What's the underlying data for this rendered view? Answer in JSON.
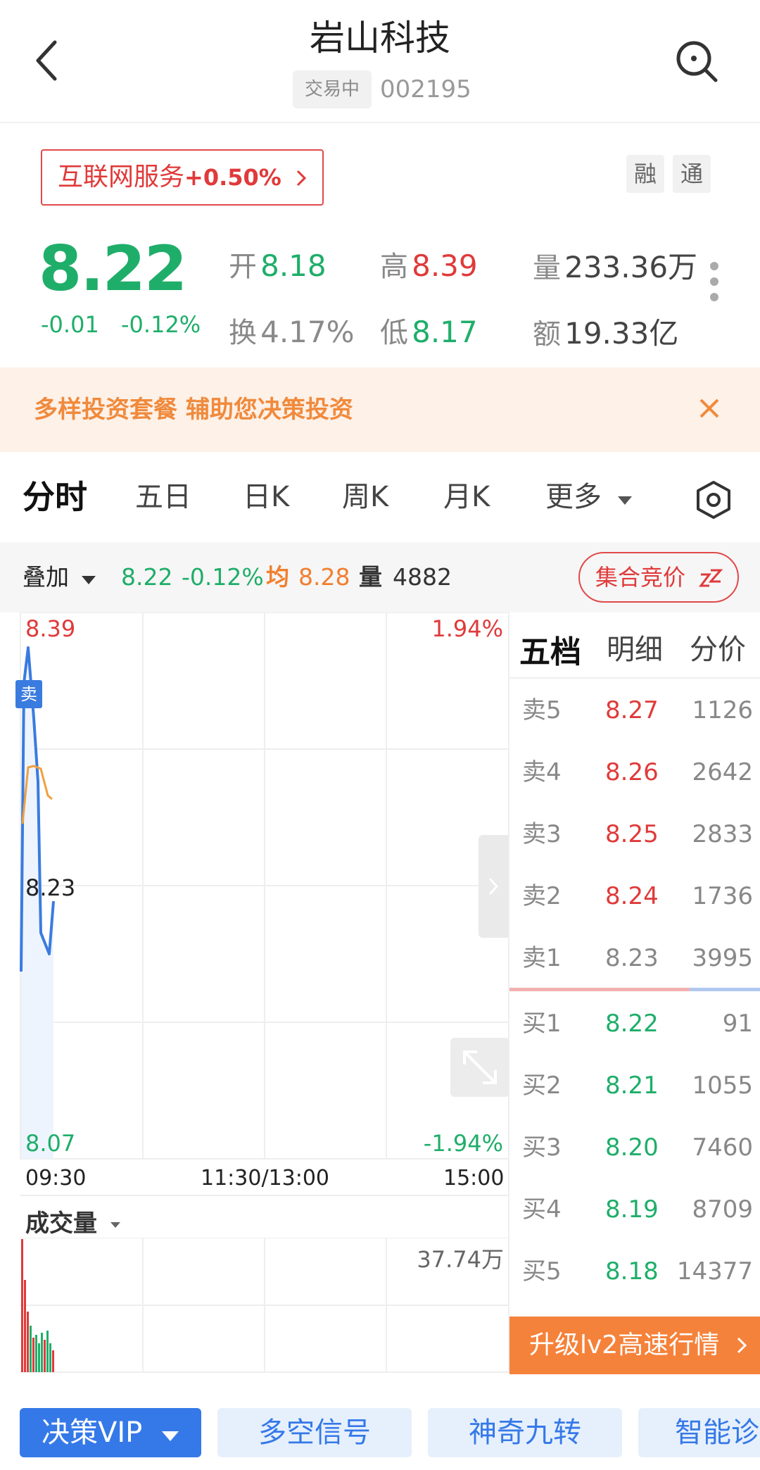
{
  "header": {
    "title": "岩山科技",
    "status": "交易中",
    "code": "002195"
  },
  "sector": {
    "name": "互联网服务",
    "change": "+0.50%",
    "tag_margin": "融",
    "tag_connect": "通"
  },
  "quote": {
    "price": "8.22",
    "change": "-0.01",
    "change_pct": "-0.12%",
    "open_label": "开",
    "open": "8.18",
    "high_label": "高",
    "high": "8.39",
    "volume_label": "量",
    "volume": "233.36万",
    "turnover_label": "换",
    "turnover": "4.17%",
    "low_label": "低",
    "low": "8.17",
    "amount_label": "额",
    "amount": "19.33亿"
  },
  "banner": {
    "text": "多样投资套餐 辅助您决策投资"
  },
  "tabs": [
    "分时",
    "五日",
    "日K",
    "周K",
    "月K",
    "更多"
  ],
  "overlay": {
    "overlay_label": "叠加",
    "price": "8.22",
    "pct": "-0.12%",
    "avg_label": "均",
    "avg": "8.28",
    "vol_label": "量",
    "vol": "4882",
    "auction": "集合竞价"
  },
  "chart": {
    "y_high": "8.39",
    "y_mid": "8.23",
    "y_low": "8.07",
    "pct_high": "1.94%",
    "pct_low": "-1.94%",
    "time_start": "09:30",
    "time_mid": "11:30/13:00",
    "time_end": "15:00",
    "sell_marker": "卖",
    "volume_title": "成交量",
    "volume_max": "37.74万",
    "colors": {
      "price_line": "#3a7be0",
      "avg_line": "#f0a040",
      "up": "#e03a3a",
      "down": "#1fae6a"
    }
  },
  "order_book": {
    "tabs": [
      "五档",
      "明细",
      "分价"
    ],
    "sells": [
      {
        "label": "卖5",
        "price": "8.27",
        "vol": "1126"
      },
      {
        "label": "卖4",
        "price": "8.26",
        "vol": "2642"
      },
      {
        "label": "卖3",
        "price": "8.25",
        "vol": "2833"
      },
      {
        "label": "卖2",
        "price": "8.24",
        "vol": "1736"
      },
      {
        "label": "卖1",
        "price": "8.23",
        "vol": "3995"
      }
    ],
    "buys": [
      {
        "label": "买1",
        "price": "8.22",
        "vol": "91"
      },
      {
        "label": "买2",
        "price": "8.21",
        "vol": "1055"
      },
      {
        "label": "买3",
        "price": "8.20",
        "vol": "7460"
      },
      {
        "label": "买4",
        "price": "8.19",
        "vol": "8709"
      },
      {
        "label": "买5",
        "price": "8.18",
        "vol": "14377"
      }
    ],
    "upgrade": "升级lv2高速行情"
  },
  "bottom_tools": [
    "决策VIP",
    "多空信号",
    "神奇九转",
    "智能诊"
  ]
}
